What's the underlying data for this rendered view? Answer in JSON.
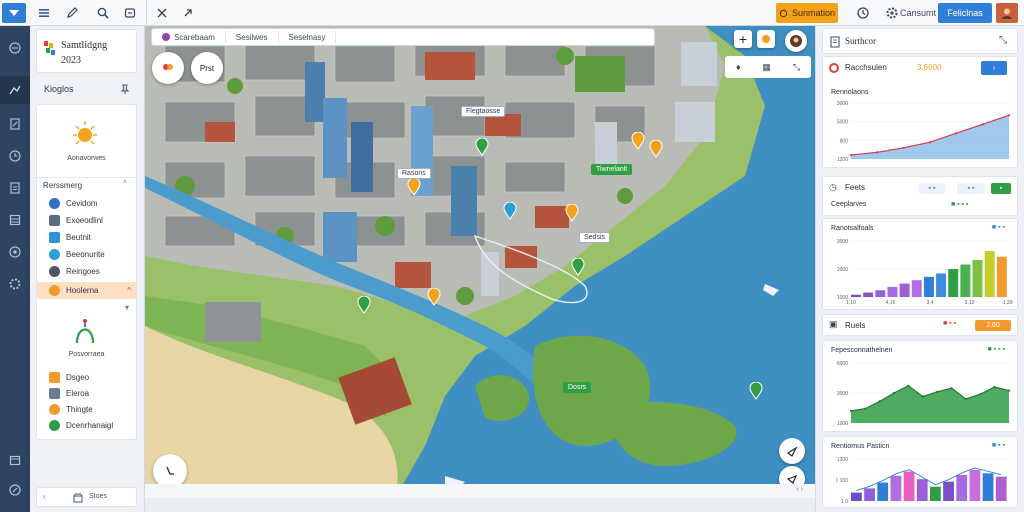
{
  "topbar": {
    "accent_button_label": "Sunmation",
    "user_label": "Cansumt",
    "primary_button_label": "Feliclnas"
  },
  "left_panel": {
    "project_title": "Samtlidgng",
    "project_year": "2023",
    "section_title": "Kioglos",
    "hero_caption": "Aonavorwes",
    "list_title": "Rerssmerg",
    "list_items": [
      {
        "label": "Cevidom",
        "color": "#2f6fc9"
      },
      {
        "label": "Exoeodlinl",
        "color": "#5b6c80"
      },
      {
        "label": "Beutnit",
        "color": "#2f8fd8"
      },
      {
        "label": "Beeonurite",
        "color": "#2a9fd6"
      },
      {
        "label": "Reingoes",
        "color": "#4b5563"
      },
      {
        "label": "Hoolerna",
        "color": "#f39a2e"
      }
    ],
    "lower_caption": "Posvorraea",
    "lower_items": [
      {
        "label": "Dsgeo",
        "color": "#f39a2e"
      },
      {
        "label": "Eleroa",
        "color": "#6b7b8c"
      },
      {
        "label": "Thingte",
        "color": "#f39a2e"
      },
      {
        "label": "Dcenrhanaigl",
        "color": "#2f9e44"
      }
    ],
    "footer_label": "Stoes"
  },
  "map": {
    "search_items": [
      "Scarebaam",
      "Sesilwes",
      "Seselnasy"
    ],
    "tags": [
      "Flegtaosse",
      "Rasons",
      "Tiwnelanlt",
      "Sedsis",
      "Dosrs"
    ],
    "zoom_label": "Prst"
  },
  "right_panel": {
    "header_title": "Surthcor",
    "card1": {
      "title": "Racchsulen",
      "range_label": "3.6000",
      "chart_title": "Renriolaons"
    },
    "card2": {
      "title": "Feets",
      "subtitle": "Ceeplarves"
    },
    "card3": {
      "title": "Ranotsalfoals"
    },
    "card4": {
      "title": "Ruels",
      "chip": "2.60"
    },
    "card5": {
      "title": "Fepesconnathelnen"
    },
    "card6": {
      "title": "Rentiomus Pasticn"
    }
  },
  "colors": {
    "accent": "#f4a11c",
    "primary": "#2f7fd8",
    "rail": "#2e4460"
  },
  "chart_data": [
    {
      "type": "area",
      "title": "Renriolaons",
      "x": [
        1,
        2,
        3,
        4,
        5,
        6,
        7
      ],
      "series": [
        {
          "values": [
            7,
            12,
            20,
            30,
            46,
            62,
            78
          ]
        }
      ],
      "ylim": [
        0,
        100
      ],
      "y_ticks": [
        "3000",
        "5000",
        "800",
        "1200"
      ]
    },
    {
      "type": "bar",
      "title": "Ranotsalfoals",
      "categories": [
        "1",
        "2",
        "3",
        "4",
        "5",
        "6",
        "7",
        "8",
        "9",
        "10",
        "11",
        "12",
        "13"
      ],
      "values": [
        4,
        8,
        12,
        18,
        24,
        30,
        36,
        42,
        50,
        58,
        66,
        82,
        72
      ],
      "ylim": [
        0,
        100
      ],
      "y_ticks": [
        "3000",
        "2000",
        "1000"
      ],
      "x_ticks": [
        "1,10",
        "4,16",
        "3,4",
        "3,12",
        "1,200"
      ]
    },
    {
      "type": "area",
      "title": "Fepesconnathelnen",
      "x": [
        1,
        2,
        3,
        4,
        5,
        6,
        7,
        8,
        9,
        10,
        11,
        12
      ],
      "series": [
        {
          "values": [
            20,
            24,
            36,
            50,
            62,
            44,
            52,
            58,
            40,
            48,
            60,
            54
          ]
        }
      ],
      "ylim": [
        0,
        100
      ],
      "y_ticks": [
        "6000",
        "3000",
        "1000"
      ]
    },
    {
      "type": "bar",
      "title": "Rentiomus Pasticn",
      "categories": [
        "1",
        "2",
        "3",
        "4",
        "5",
        "6",
        "7",
        "8",
        "9",
        "10",
        "11",
        "12"
      ],
      "values": [
        20,
        30,
        44,
        60,
        70,
        52,
        34,
        46,
        62,
        74,
        66,
        58
      ],
      "ylim": [
        0,
        100
      ],
      "y_ticks": [
        "1200",
        "1 100",
        "1 0"
      ]
    }
  ]
}
